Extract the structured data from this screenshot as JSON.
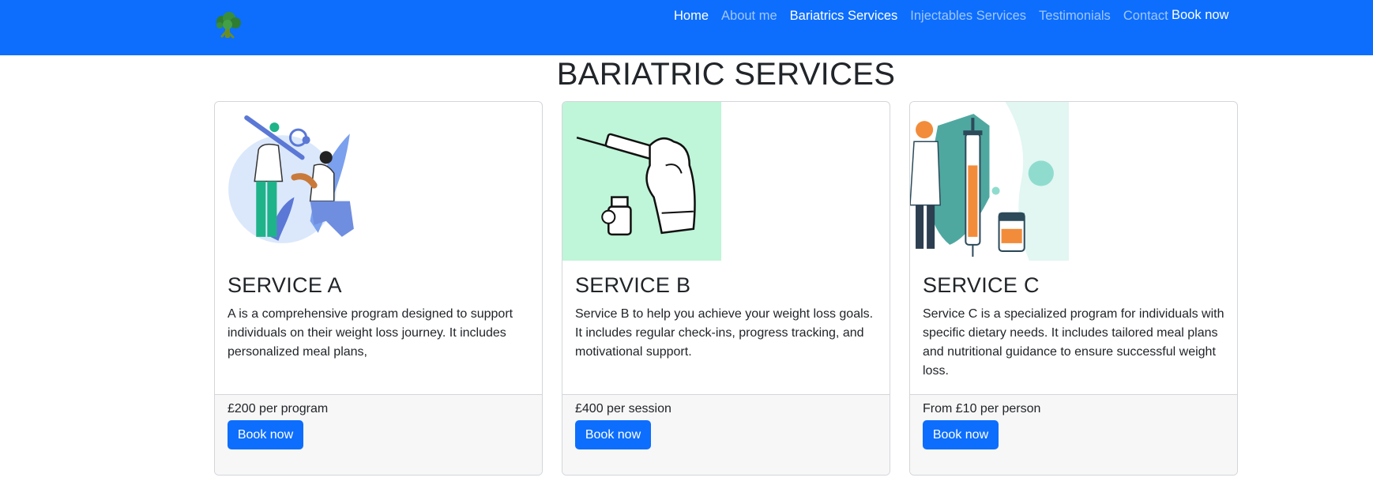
{
  "nav": {
    "logo": "broccoli-icon",
    "links": [
      {
        "label": "Home",
        "active": true
      },
      {
        "label": "About me"
      },
      {
        "label": "Bariatrics Services"
      },
      {
        "label": "Injectables Services"
      },
      {
        "label": "Testimonials"
      },
      {
        "label": "Contact"
      }
    ],
    "book_label": "Book now",
    "bg_color": "#0d6efd"
  },
  "page": {
    "title": "BARIATRIC SERVICES"
  },
  "services": [
    {
      "image": "vaccination-illustration",
      "title": "SERVICE A",
      "description": "A is a comprehensive program designed to support individuals on their weight loss journey. It includes personalized meal plans,",
      "price": "£200 per program",
      "button": "Book now"
    },
    {
      "image": "syringe-vial-illustration",
      "title": "SERVICE B",
      "description": "Service B to help you achieve your weight loss goals. It includes regular check-ins, progress tracking, and motivational support.",
      "price": "£400 per session",
      "button": "Book now"
    },
    {
      "image": "doctor-syringe-illustration",
      "title": "SERVICE C",
      "description": "Service C is a specialized program for individuals with specific dietary needs. It includes tailored meal plans and nutritional guidance to ensure successful weight loss.",
      "price": "From £10 per person",
      "button": "Book now"
    }
  ]
}
